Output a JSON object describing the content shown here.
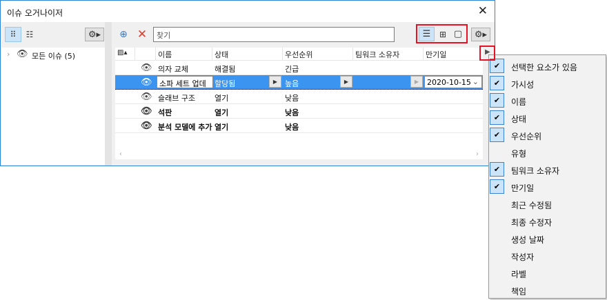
{
  "window": {
    "title": "이슈 오거나이저",
    "close": "✕"
  },
  "left": {
    "tree_item": "모든 이슈 (5)"
  },
  "toolbar": {
    "search_placeholder": "찾기"
  },
  "table": {
    "headers": [
      "이름",
      "상태",
      "우선순위",
      "팀워크 소유자",
      "만기일"
    ],
    "rows": [
      {
        "name": "의자 교체",
        "status": "해결됨",
        "priority": "긴급",
        "owner": "",
        "due": "",
        "bold": false
      },
      {
        "name": "소파 세트 업데",
        "status": "할당됨",
        "priority": "높음",
        "owner": "",
        "due": "2020-10-15",
        "bold": false,
        "selected": true
      },
      {
        "name": "슬래브 구조",
        "status": "열기",
        "priority": "낮음",
        "owner": "",
        "due": "",
        "bold": false
      },
      {
        "name": "석판",
        "status": "열기",
        "priority": "낮음",
        "owner": "",
        "due": "",
        "bold": true
      },
      {
        "name": "분석 모델에 추가",
        "status": "열기",
        "priority": "낮음",
        "owner": "",
        "due": "",
        "bold": true
      }
    ]
  },
  "menu": {
    "items": [
      {
        "label": "선택한 요소가 있음",
        "checked": true
      },
      {
        "label": "가시성",
        "checked": true
      },
      {
        "label": "이름",
        "checked": true
      },
      {
        "label": "상태",
        "checked": true
      },
      {
        "label": "우선순위",
        "checked": true
      },
      {
        "label": "유형",
        "checked": false
      },
      {
        "label": "팀워크 소유자",
        "checked": true
      },
      {
        "label": "만기일",
        "checked": true
      },
      {
        "label": "최근 수정됨",
        "checked": false
      },
      {
        "label": "최종 수정자",
        "checked": false
      },
      {
        "label": "생성 날짜",
        "checked": false
      },
      {
        "label": "작성자",
        "checked": false
      },
      {
        "label": "라벨",
        "checked": false
      },
      {
        "label": "책임",
        "checked": false
      }
    ]
  }
}
